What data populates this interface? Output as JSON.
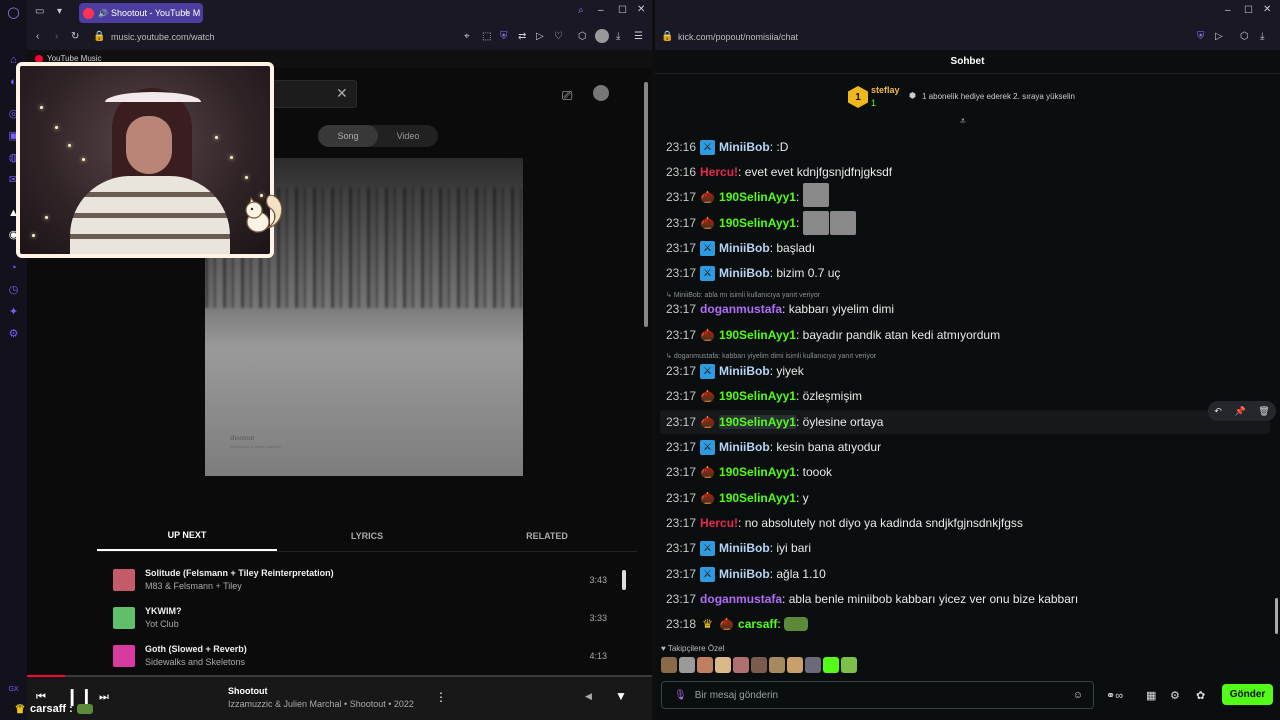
{
  "left_browser": {
    "tab": {
      "title": "Shootout - YouTube M"
    },
    "url": "music.youtube.com/watch",
    "ytm_header": "YouTube Music",
    "toggle": {
      "song": "Song",
      "video": "Video"
    },
    "album_art": {
      "title": "shootout",
      "subtitle": "Izzamuzzic & Julien Marchal"
    },
    "tabs": [
      "UP NEXT",
      "LYRICS",
      "RELATED"
    ],
    "queue": [
      {
        "title": "Solitude (Felsmann + Tiley Reinterpretation)",
        "artist": "M83 & Felsmann + Tiley",
        "duration": "3:43",
        "color": "#c45a6a"
      },
      {
        "title": "YKWIM?",
        "artist": "Yot Club",
        "duration": "3:33",
        "color": "#5fbf6a"
      },
      {
        "title": "Goth (Slowed + Reverb)",
        "artist": "Sidewalks and Skeletons",
        "duration": "4:13",
        "color": "#d83aa0"
      }
    ],
    "player": {
      "title": "Shootout",
      "subtitle": "Izzamuzzic & Julien Marchal • Shootout • 2022",
      "progress": 0.06
    },
    "overlay_user": "carsaff :"
  },
  "right_browser": {
    "url": "kick.com/popout/nomisiia/chat",
    "chat_title": "Sohbet",
    "gift": {
      "rank": "1",
      "user": "steflay",
      "count": "1",
      "text": "1 abonelik hediye ederek 2. sıraya yükselin"
    },
    "colors": {
      "blue_user": "#b6d4f5",
      "red_user": "#e8294e",
      "green_user": "#53fc18",
      "purple_user": "#b06cf7"
    },
    "messages": [
      {
        "time": "23:16",
        "badge": "blue",
        "user": "MiniiBob",
        "color": "#b6d4f5",
        "text": ":D"
      },
      {
        "time": "23:16",
        "badge": "",
        "user": "Hercu!",
        "color": "#e8294e",
        "text": "evet evet kdnjfgsnjdfnjgksdf"
      },
      {
        "time": "23:17",
        "badge": "acorn",
        "user": "190SelinAyy1",
        "color": "#53fc18",
        "text": ""
      },
      {
        "time": "23:17",
        "badge": "acorn",
        "user": "190SelinAyy1",
        "color": "#53fc18",
        "text": ""
      },
      {
        "time": "23:17",
        "badge": "blue",
        "user": "MiniiBob",
        "color": "#b6d4f5",
        "text": "başladı"
      },
      {
        "time": "23:17",
        "badge": "blue",
        "user": "MiniiBob",
        "color": "#b6d4f5",
        "text": "bizim 0.7 uç"
      },
      {
        "time": "23:17",
        "badge": "",
        "user": "doganmustafa",
        "color": "#b06cf7",
        "text": "kabbarı yiyelim dimi"
      },
      {
        "time": "23:17",
        "badge": "acorn",
        "user": "190SelinAyy1",
        "color": "#53fc18",
        "text": "bayadır pandik atan kedi atmıyordum"
      },
      {
        "time": "23:17",
        "badge": "blue",
        "user": "MiniiBob",
        "color": "#b6d4f5",
        "text": "yiyek"
      },
      {
        "time": "23:17",
        "badge": "acorn",
        "user": "190SelinAyy1",
        "color": "#53fc18",
        "text": "özleşmişim"
      },
      {
        "time": "23:17",
        "badge": "acorn",
        "user": "190SelinAyy1",
        "color": "#53fc18",
        "text": "öylesine ortaya"
      },
      {
        "time": "23:17",
        "badge": "blue",
        "user": "MiniiBob",
        "color": "#b6d4f5",
        "text": "kesin bana atıyodur"
      },
      {
        "time": "23:17",
        "badge": "acorn",
        "user": "190SelinAyy1",
        "color": "#53fc18",
        "text": "toook"
      },
      {
        "time": "23:17",
        "badge": "acorn",
        "user": "190SelinAyy1",
        "color": "#53fc18",
        "text": "y"
      },
      {
        "time": "23:17",
        "badge": "",
        "user": "Hercu!",
        "color": "#e8294e",
        "text": "no absolutely not diyo ya kadinda sndjkfgjnsdnkjfgss"
      },
      {
        "time": "23:17",
        "badge": "blue",
        "user": "MiniiBob",
        "color": "#b6d4f5",
        "text": "iyi bari"
      },
      {
        "time": "23:17",
        "badge": "blue",
        "user": "MiniiBob",
        "color": "#b6d4f5",
        "text": "ağla 1.10"
      },
      {
        "time": "23:17",
        "badge": "",
        "user": "doganmustafa",
        "color": "#b06cf7",
        "text": "abla benle miniibob kabbarı yicez ver onu bize kabbarı"
      },
      {
        "time": "23:18",
        "badge": "crown",
        "user": "carsaff",
        "color": "#53fc18",
        "text": ""
      }
    ],
    "replies": [
      "MiniiBob: abla mı isimli kullanıcıya yanıt veriyor",
      "doganmustafa: kabbarı yiyelim dimi isimli kullanıcıya yanıt veriyor"
    ],
    "followers_only": "Takipçilere Özel",
    "input_placeholder": "Bir mesaj gönderin",
    "send_label": "Gönder"
  }
}
